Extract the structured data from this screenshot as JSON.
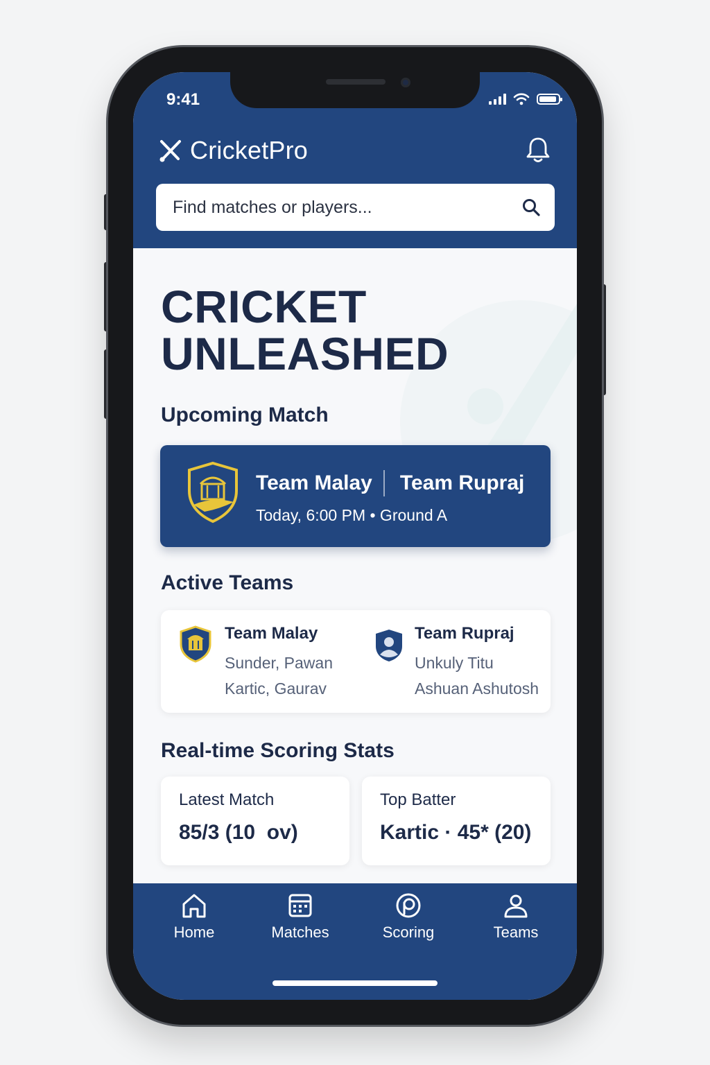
{
  "status_bar": {
    "time": "9:41"
  },
  "header": {
    "app_name": "CricketPro",
    "search_placeholder": "Find matches or players..."
  },
  "hero": {
    "line1": "CRICKET",
    "line2": "UNLEASHED"
  },
  "upcoming": {
    "title": "Upcoming Match",
    "team_a": "Team Malay",
    "team_b": "Team Rupraj",
    "meta": "Today, 6:00 PM • Ground A"
  },
  "active_teams": {
    "title": "Active Teams",
    "teams": [
      {
        "name": "Team Malay",
        "members": [
          "Sunder, Pawan",
          "Kartic, Gaurav"
        ]
      },
      {
        "name": "Team Rupraj",
        "members": [
          "Unkuly Titu",
          "Ashuan Ashutosh"
        ]
      }
    ]
  },
  "stats": {
    "title": "Real-time Scoring Stats",
    "latest_match": {
      "label": "Latest Match",
      "value": "85/3 (10  ov)"
    },
    "top_batter": {
      "label": "Top Batter",
      "value": "Kartic · 45* (20)"
    }
  },
  "nav": {
    "items": [
      {
        "label": "Home",
        "icon": "home-icon"
      },
      {
        "label": "Matches",
        "icon": "calendar-icon"
      },
      {
        "label": "Scoring",
        "icon": "scoring-icon"
      },
      {
        "label": "Teams",
        "icon": "user-icon"
      }
    ]
  },
  "colors": {
    "primary": "#22467f",
    "text_dark": "#1d2a48",
    "accent_gold": "#e8c53a"
  }
}
